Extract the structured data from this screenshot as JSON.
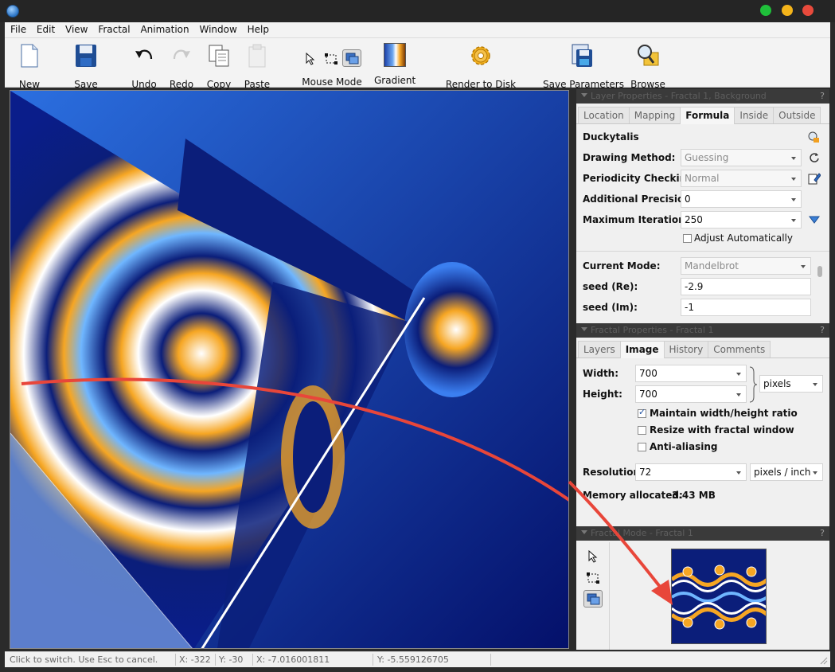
{
  "menu": [
    "File",
    "Edit",
    "View",
    "Fractal",
    "Animation",
    "Window",
    "Help"
  ],
  "toolbar": {
    "new": "New",
    "save": "Save",
    "undo": "Undo",
    "redo": "Redo",
    "copy": "Copy",
    "paste": "Paste",
    "mouse_mode": "Mouse Mode",
    "gradient": "Gradient",
    "render": "Render to Disk",
    "save_params": "Save Parameters",
    "browse": "Browse"
  },
  "layer_panel": {
    "header": "Layer Properties - Fractal 1, Background",
    "tabs": [
      "Location",
      "Mapping",
      "Formula",
      "Inside",
      "Outside"
    ],
    "active_tab": "Formula",
    "formula_name": "Duckytalis",
    "drawing_method_label": "Drawing Method:",
    "drawing_method": "Guessing",
    "periodicity_label": "Periodicity Checking",
    "periodicity": "Normal",
    "precision_label": "Additional Precision:",
    "precision": "0",
    "max_iter_label": "Maximum Iterations",
    "max_iter": "250",
    "adjust_auto": "Adjust Automatically",
    "current_mode_label": "Current Mode:",
    "current_mode": "Mandelbrot",
    "seed_re_label": "seed (Re):",
    "seed_re": "-2.9",
    "seed_im_label": "seed (Im):",
    "seed_im": "-1"
  },
  "fractal_panel": {
    "header": "Fractal Properties - Fractal 1",
    "tabs": [
      "Layers",
      "Image",
      "History",
      "Comments"
    ],
    "active_tab": "Image",
    "width_label": "Width:",
    "width": "700",
    "height_label": "Height:",
    "height": "700",
    "units": "pixels",
    "maintain_ratio": "Maintain width/height ratio",
    "resize_window": "Resize with fractal window",
    "anti_alias": "Anti-aliasing",
    "resolution_label": "Resolution:",
    "resolution": "72",
    "resolution_units": "pixels / inch",
    "memory_label": "Memory allocated:",
    "memory": "3.43 MB"
  },
  "mode_panel": {
    "header": "Fractal Mode - Fractal 1"
  },
  "status": {
    "hint": "Click to switch. Use Esc to cancel.",
    "x": "X: -322",
    "y": "Y: -30",
    "cx": "X: -7.016001811",
    "cy": "Y: -5.559126705"
  },
  "colors": {
    "arrow": "#e8463a",
    "fractal_bg": "#0a1d8a",
    "accent": "#f6a623"
  }
}
